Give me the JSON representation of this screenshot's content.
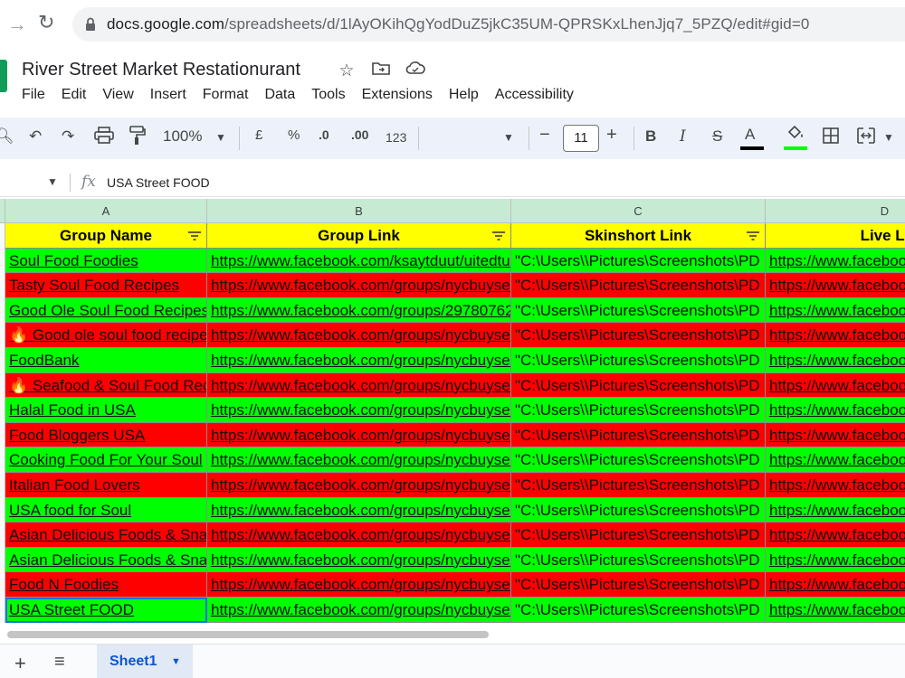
{
  "browser": {
    "url_domain": "docs.google.com",
    "url_path": "/spreadsheets/d/1lAyOKihQgYodDuZ5jkC35UM-QPRSKxLhenJjq7_5PZQ/edit#gid=0"
  },
  "doc": {
    "title": "River Street Market Restationurant",
    "menu": [
      "File",
      "Edit",
      "View",
      "Insert",
      "Format",
      "Data",
      "Tools",
      "Extensions",
      "Help",
      "Accessibility"
    ]
  },
  "toolbar": {
    "zoom": "100%",
    "currency": "£",
    "percent": "%",
    "decrease_decimal": ".0",
    "increase_decimal": ".00",
    "number_format": "123",
    "font_size": "11",
    "minus": "−",
    "plus": "+",
    "bold": "B",
    "italic": "I",
    "strikethrough": "S",
    "text_color": "A"
  },
  "formula_bar": {
    "fx": "fx",
    "content": "USA Street FOOD"
  },
  "columns": [
    "A",
    "B",
    "C",
    "D"
  ],
  "header_row": [
    "Group Name",
    "Group Link",
    "Skinshort Link",
    "Live Li"
  ],
  "rows": [
    {
      "color": "green",
      "name": "Soul Food Foodies",
      "link": "https://www.facebook.com/ksaytduut/uitedtu",
      "shot": "\"C:\\Users\\\\Pictures\\Screenshots\\PD",
      "live": "https://www.faceboo"
    },
    {
      "color": "red",
      "name": "Tasty Soul Food Recipes",
      "link": "https://www.facebook.com/groups/nycbuysel",
      "shot": "\"C:\\Users\\\\Pictures\\Screenshots\\PD",
      "live": "https://www.faceboo"
    },
    {
      "color": "green",
      "name": "Good Ole Soul Food Recipes",
      "link": "https://www.facebook.com/groups/29780762",
      "shot": "\"C:\\Users\\\\Pictures\\Screenshots\\PD",
      "live": "https://www.faceboo"
    },
    {
      "color": "red",
      "name": "🔥 Good ole soul food recipes",
      "link": "https://www.facebook.com/groups/nycbuysel",
      "shot": "\"C:\\Users\\\\Pictures\\Screenshots\\PD",
      "live": "https://www.faceboo"
    },
    {
      "color": "green",
      "name": "FoodBank",
      "link": "https://www.facebook.com/groups/nycbuysel",
      "shot": "\"C:\\Users\\\\Pictures\\Screenshots\\PD",
      "live": "https://www.faceboo"
    },
    {
      "color": "red",
      "name": "🔥 Seafood & Soul Food Recipes",
      "link": "https://www.facebook.com/groups/nycbuysel",
      "shot": "\"C:\\Users\\\\Pictures\\Screenshots\\PD",
      "live": "https://www.faceboo"
    },
    {
      "color": "green",
      "name": "Halal Food in USA",
      "link": "https://www.facebook.com/groups/nycbuysel",
      "shot": "\"C:\\Users\\\\Pictures\\Screenshots\\PD",
      "live": "https://www.faceboo"
    },
    {
      "color": "red",
      "name": "Food Bloggers USA",
      "link": "https://www.facebook.com/groups/nycbuysel",
      "shot": "\"C:\\Users\\\\Pictures\\Screenshots\\PD",
      "live": "https://www.faceboo"
    },
    {
      "color": "green",
      "name": "Cooking Food For Your Soul",
      "link": "https://www.facebook.com/groups/nycbuysel",
      "shot": "\"C:\\Users\\\\Pictures\\Screenshots\\PD",
      "live": "https://www.faceboo"
    },
    {
      "color": "red",
      "name": "Italian Food Lovers",
      "link": "https://www.facebook.com/groups/nycbuysel",
      "shot": "\"C:\\Users\\\\Pictures\\Screenshots\\PD",
      "live": "https://www.faceboo"
    },
    {
      "color": "green",
      "name": "USA food for Soul",
      "link": "https://www.facebook.com/groups/nycbuysel",
      "shot": "\"C:\\Users\\\\Pictures\\Screenshots\\PD",
      "live": "https://www.faceboo"
    },
    {
      "color": "red",
      "name": "Asian Delicious Foods & Snacks",
      "link": "https://www.facebook.com/groups/nycbuysel",
      "shot": "\"C:\\Users\\\\Pictures\\Screenshots\\PD",
      "live": "https://www.faceboo"
    },
    {
      "color": "green",
      "name": "Asian Delicious Foods & Snacks",
      "link": "https://www.facebook.com/groups/nycbuysel",
      "shot": "\"C:\\Users\\\\Pictures\\Screenshots\\PD",
      "live": "https://www.faceboo"
    },
    {
      "color": "red",
      "name": "Food N Foodies",
      "link": "https://www.facebook.com/groups/nycbuysel",
      "shot": "\"C:\\Users\\\\Pictures\\Screenshots\\PD",
      "live": "https://www.faceboo"
    },
    {
      "color": "green",
      "name": "USA Street FOOD",
      "link": "https://www.facebook.com/groups/nycbuysel",
      "shot": "\"C:\\Users\\\\Pictures\\Screenshots\\PD",
      "live": "https://www.faceboo"
    }
  ],
  "sheet_tabs": [
    "Sheet1"
  ],
  "colors": {
    "green": "#00ff00",
    "red": "#ff0000",
    "header_yellow": "#ffff00",
    "col_header": "#c6ead2"
  }
}
